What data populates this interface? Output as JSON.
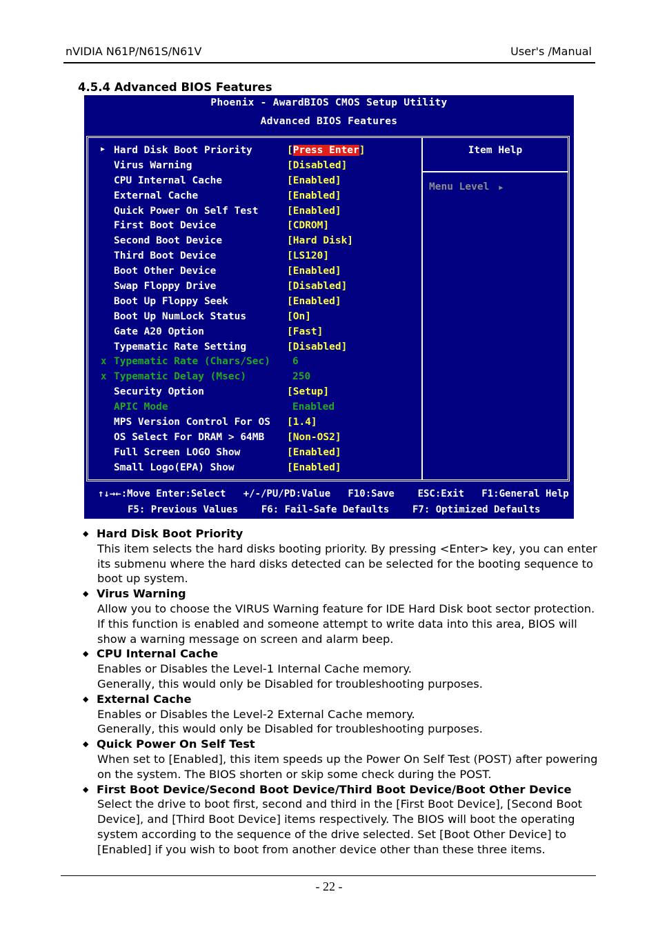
{
  "header": {
    "left": "nVIDIA N61P/N61S/N61V",
    "right": "User's /Manual"
  },
  "section_title": "4.5.4 Advanced BIOS Features",
  "bios": {
    "title": "Phoenix - AwardBIOS CMOS Setup Utility",
    "subtitle": "Advanced BIOS Features",
    "help_title": "Item Help",
    "menu_level": "Menu Level",
    "menu_level_icon": "triangle-right-icon",
    "items": [
      {
        "label": "Hard Disk Boot Priority",
        "value_prefix": "[",
        "value": "Press Enter",
        "value_suffix": "]",
        "marker": "submenu",
        "highlighted": true
      },
      {
        "label": "Virus Warning",
        "value": "[Disabled]"
      },
      {
        "label": "CPU Internal Cache",
        "value": "[Enabled]"
      },
      {
        "label": "External Cache",
        "value": "[Enabled]"
      },
      {
        "label": "Quick Power On Self Test",
        "value": "[Enabled]"
      },
      {
        "label": "First Boot Device",
        "value": "[CDROM]"
      },
      {
        "label": "Second Boot Device",
        "value": "[Hard Disk]"
      },
      {
        "label": "Third Boot Device",
        "value": "[LS120]"
      },
      {
        "label": "Boot Other Device",
        "value": "[Enabled]"
      },
      {
        "label": "Swap Floppy Drive",
        "value": "[Disabled]"
      },
      {
        "label": "Boot Up Floppy Seek",
        "value": "[Enabled]"
      },
      {
        "label": "Boot Up NumLock Status",
        "value": "[On]"
      },
      {
        "label": "Gate A20 Option",
        "value": "[Fast]"
      },
      {
        "label": "Typematic Rate Setting",
        "value": "[Disabled]"
      },
      {
        "label": "Typematic Rate (Chars/Sec)",
        "value": "6",
        "marker": "x",
        "disabled": true
      },
      {
        "label": "Typematic Delay (Msec)",
        "value": "250",
        "marker": "x",
        "disabled": true
      },
      {
        "label": "Security Option",
        "value": "[Setup]"
      },
      {
        "label": "APIC Mode",
        "value": "Enabled",
        "disabled": true
      },
      {
        "label": "MPS Version Control For OS",
        "value": "[1.4]"
      },
      {
        "label": "OS Select For DRAM > 64MB",
        "value": "[Non-OS2]"
      },
      {
        "label": "Full Screen LOGO Show",
        "value": "[Enabled]"
      },
      {
        "label": "Small Logo(EPA) Show",
        "value": "[Enabled]"
      }
    ],
    "keys_line1": "↑↓→←:Move Enter:Select   +/-/PU/PD:Value   F10:Save    ESC:Exit   F1:General Help",
    "keys_line2": "F5: Previous Values    F6: Fail-Safe Defaults    F7: Optimized Defaults",
    "colors": {
      "background": "#000080",
      "label": "#ffffff",
      "value": "#ffff40",
      "disabled": "#22aa22",
      "highlight": "#e0201a",
      "menu_level": "#8c8c8c"
    }
  },
  "descriptions": [
    {
      "title": "Hard Disk Boot Priority",
      "lines": [
        "This item selects the hard disks booting priority. By pressing <Enter> key, you can enter",
        "its submenu where the hard disks detected can be selected for the booting sequence to",
        "boot up system."
      ]
    },
    {
      "title": "Virus Warning",
      "lines": [
        "Allow you to choose the VIRUS Warning feature for IDE Hard Disk boot sector protection.",
        "If this function is enabled and someone attempt to write data into this area, BIOS will",
        "show a warning message on screen and alarm beep."
      ]
    },
    {
      "title": "CPU Internal Cache",
      "lines": [
        "Enables or Disables the Level-1 Internal Cache memory.",
        "Generally, this would only be Disabled for troubleshooting purposes."
      ]
    },
    {
      "title": "External Cache",
      "lines": [
        "Enables or Disables the Level-2 External Cache memory.",
        "Generally, this would only be Disabled for troubleshooting purposes."
      ]
    },
    {
      "title": "Quick Power On Self Test",
      "lines": [
        "When set to [Enabled], this item speeds up the Power On Self Test (POST) after powering",
        "on the system. The BIOS shorten or skip some check during the POST."
      ]
    },
    {
      "title": "First Boot Device/Second Boot Device/Third Boot Device/Boot Other Device",
      "lines": [
        "Select the drive to boot first, second and third in the [First Boot Device], [Second Boot",
        "Device], and [Third Boot Device] items respectively. The BIOS will boot the operating",
        "system according to the sequence of the drive selected. Set [Boot Other Device] to",
        "[Enabled] if you wish to boot from another device other than these three items."
      ]
    }
  ],
  "bullet_icon": "diamond-bullet-icon",
  "page_number": "- 22 -"
}
